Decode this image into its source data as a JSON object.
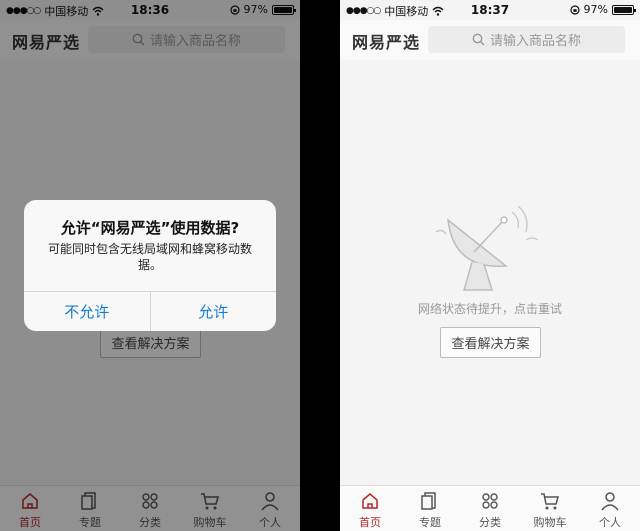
{
  "status_left": {
    "carrier": "中国移动",
    "signal": "●●●○○"
  },
  "status_right": {
    "battery": "97%"
  },
  "screen_left": {
    "time": "18:36"
  },
  "screen_right": {
    "time": "18:37"
  },
  "header": {
    "logo": "网易严选",
    "search_placeholder": "请输入商品名称"
  },
  "content": {
    "network_message": "网络状态待提升，点击重试",
    "retry_button": "查看解决方案"
  },
  "tabs": [
    {
      "label": "首页",
      "icon": "home-icon",
      "active": true
    },
    {
      "label": "专题",
      "icon": "topic-icon"
    },
    {
      "label": "分类",
      "icon": "category-icon"
    },
    {
      "label": "购物车",
      "icon": "cart-icon"
    },
    {
      "label": "个人",
      "icon": "user-icon"
    }
  ],
  "alert": {
    "title": "允许“网易严选”使用数据?",
    "message": "可能同时包含无线局域网和蜂窝移动数据。",
    "deny": "不允许",
    "allow": "允许"
  },
  "colors": {
    "accent": "#b4282d",
    "ios_blue": "#147cd5",
    "background": "#f4f4f4"
  }
}
